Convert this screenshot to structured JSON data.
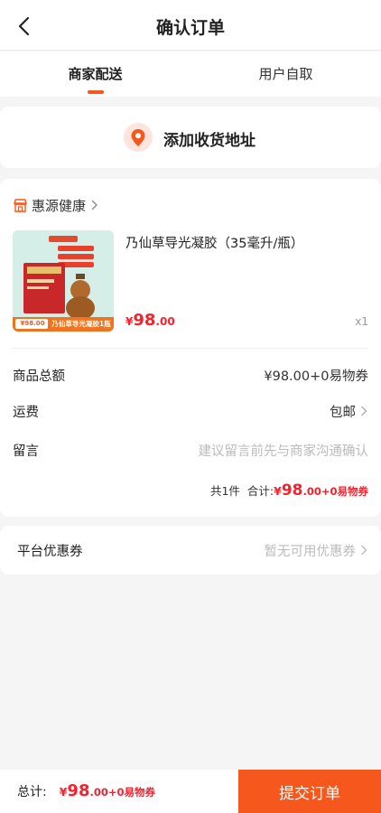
{
  "header": {
    "title": "确认订单"
  },
  "tabs": [
    {
      "label": "商家配送",
      "active": true
    },
    {
      "label": "用户自取",
      "active": false
    }
  ],
  "address": {
    "label": "添加收货地址"
  },
  "shop": {
    "name": "惠源健康"
  },
  "product": {
    "name": "乃仙草导光凝胶（35毫升/瓶）",
    "price_symbol": "¥",
    "price_int": "98",
    "price_dec": ".00",
    "qty": "x1",
    "img_tag": "¥98.00",
    "img_caption": "乃仙草导光凝胶1瓶"
  },
  "rows": {
    "total_label": "商品总额",
    "total_value": "¥98.00+0易物券",
    "shipping_label": "运费",
    "shipping_value": "包邮",
    "message_label": "留言",
    "message_placeholder": "建议留言前先与商家沟通确认"
  },
  "summary": {
    "count_text": "共1件",
    "total_label": "合计:",
    "price_symbol": "¥",
    "price_int": "98",
    "price_rest": ".00+0易物券"
  },
  "coupon": {
    "label": "平台优惠券",
    "value": "暂无可用优惠券"
  },
  "footer": {
    "total_label": "总计:",
    "price_symbol": "¥",
    "price_int": "98",
    "price_rest": ".00+0易物券",
    "submit_label": "提交订单"
  },
  "colors": {
    "accent": "#f5571d",
    "price": "#f5222d"
  }
}
